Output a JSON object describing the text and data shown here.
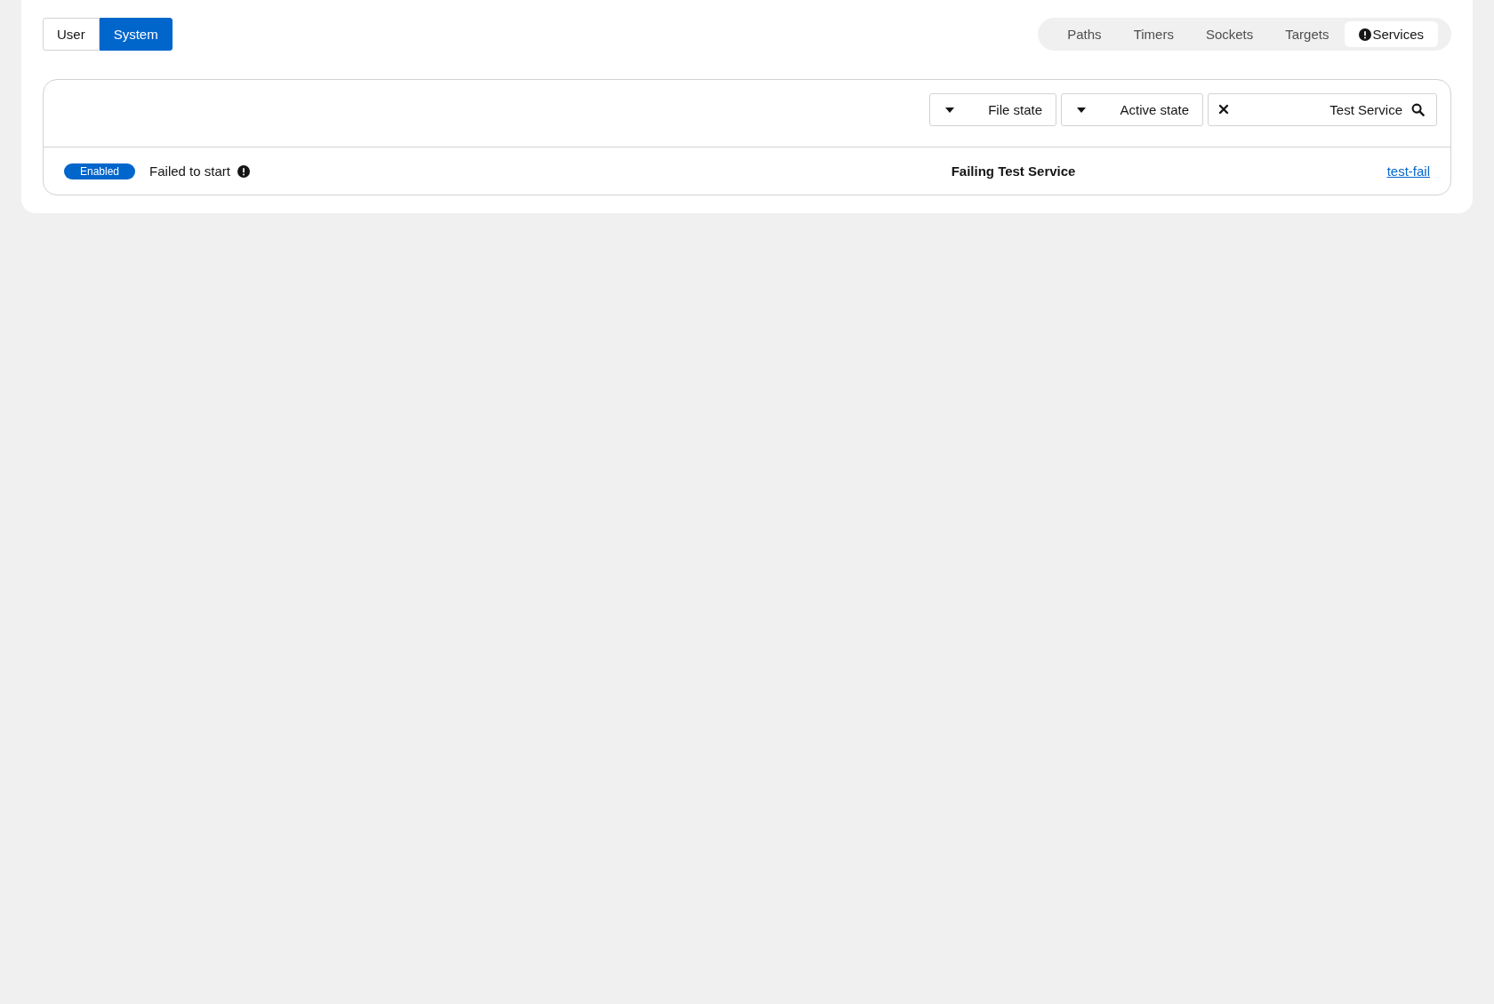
{
  "scope_toggle": [
    {
      "label": "User",
      "selected": false
    },
    {
      "label": "System",
      "selected": true
    }
  ],
  "unit_tabs": [
    {
      "label": "Paths",
      "selected": false,
      "warning": false
    },
    {
      "label": "Timers",
      "selected": false,
      "warning": false
    },
    {
      "label": "Sockets",
      "selected": false,
      "warning": false
    },
    {
      "label": "Targets",
      "selected": false,
      "warning": false
    },
    {
      "label": "Services",
      "selected": true,
      "warning": true
    }
  ],
  "filters": [
    {
      "label": "File state"
    },
    {
      "label": "Active state"
    }
  ],
  "search": {
    "value": "Test Service"
  },
  "rows": [
    {
      "badge": "Enabled",
      "status": "Failed to start",
      "warning": true,
      "description": "Failing Test Service",
      "link": "test-fail"
    }
  ]
}
